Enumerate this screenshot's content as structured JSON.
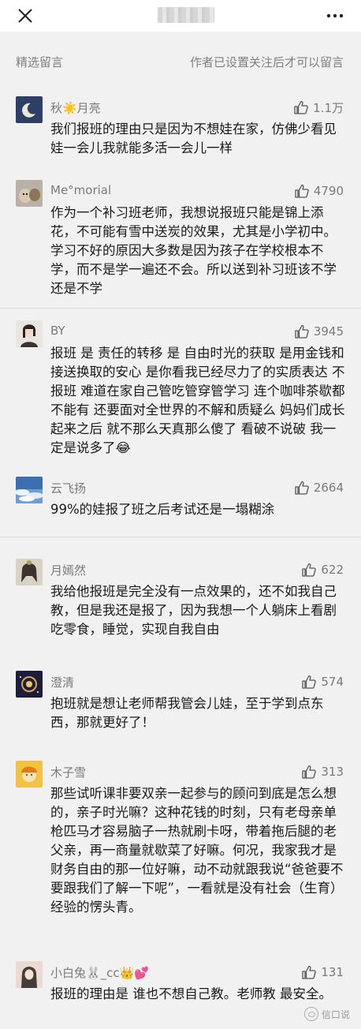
{
  "header": {
    "title": "信口说",
    "close_icon": "close-icon",
    "more_icon": "more-icon"
  },
  "section": {
    "left_label": "精选留言",
    "right_label": "作者已设置关注后才可以留言"
  },
  "comments": [
    {
      "nick": "秋☀️月亮",
      "likes": "1.1万",
      "text": "我们报班的理由只是因为不想娃在家，仿佛少看见娃一会儿我就能多活一会儿一样"
    },
    {
      "nick": "Me°morial",
      "likes": "4790",
      "text": "作为一个补习班老师，我想说报班只能是锦上添花，不可能有雪中送炭的效果，尤其是小学初中。学习不好的原因大多数是因为孩子在学校根本不学，而不是学一遍还不会。所以送到补习班该不学还是不学"
    },
    {
      "nick": "BY",
      "likes": "3945",
      "text": "报班 是 责任的转移 是 自由时光的获取 是用金钱和接送换取的安心 是你看我已经尽力了的实质表达 不报班 难道在家自己管吃管穿管学习 连个咖啡茶歇都不能有 还要面对全世界的不解和质疑么 妈妈们成长起来之后 就不那么天真那么傻了 看破不说破 我一定是说多了😂"
    },
    {
      "nick": "云飞扬",
      "likes": "2664",
      "text": "99%的娃报了班之后考试还是一塌糊涂"
    },
    {
      "nick": "月嫣然",
      "likes": "622",
      "text": "我给他报班是完全没有一点效果的，还不如我自己教，但是我还是报了，因为我想一个人躺床上看剧吃零食，睡觉，实现自我自由"
    },
    {
      "nick": "澄清",
      "likes": "574",
      "text": "抱班就是想让老师帮我管会儿娃，至于学到点东西，那就更好了！"
    },
    {
      "nick": "木子雪",
      "likes": "313",
      "text": "那些试听课非要双亲一起参与的顾问到底是怎么想的，亲子时光嘛？这种花钱的时刻，只有老母亲单枪匹马才容易脑子一热就刷卡呀，带着拖后腿的老父亲，再一商量就歇菜了好嘛。何况，我家我才是财务自由的那一位好嘛，动不动就跟我说“爸爸要不要跟我们了解一下呢”，一看就是没有社会（生育）经验的愣头青。"
    },
    {
      "nick": "小白兔🐰_cc👑💕",
      "likes": "131",
      "text": "报班的理由是 谁也不想自己教。老师教 最安全。"
    }
  ],
  "colors": {
    "page_bg": "#f1f1f1",
    "nick": "#7a7a7a",
    "text": "#1a1a1a",
    "divider": "#dcdcdc"
  }
}
